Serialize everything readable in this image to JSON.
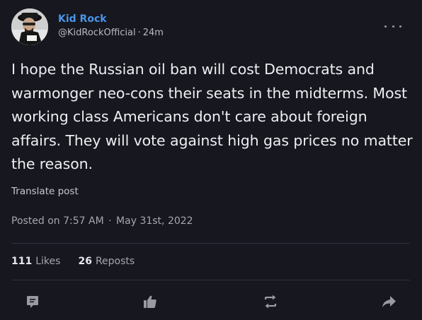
{
  "author": {
    "display_name": "Kid Rock",
    "handle": "@KidRockOfficial",
    "time_ago": "24m"
  },
  "post": {
    "text": "I hope the Russian oil ban will cost Democrats and warmonger neo-cons their seats in the midterms. Most working class Americans don't care about foreign affairs. They will vote against high gas prices no matter the reason.",
    "translate_label": "Translate post",
    "posted_prefix": "Posted on",
    "posted_time": "7:57 AM",
    "posted_date": "May 31st, 2022"
  },
  "stats": {
    "likes_count": "111",
    "likes_label": "Likes",
    "reposts_count": "26",
    "reposts_label": "Reposts"
  },
  "actions": {
    "reply_icon": "comment-icon",
    "like_icon": "thumbs-up-icon",
    "repost_icon": "repost-icon",
    "share_icon": "share-icon"
  },
  "colors": {
    "background": "#16171f",
    "accent": "#4b95e8",
    "icon": "#9a9aa4"
  }
}
